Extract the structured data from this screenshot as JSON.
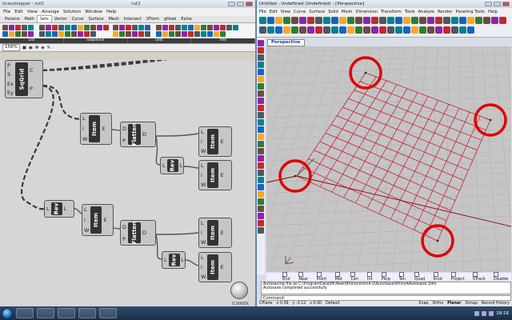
{
  "gh": {
    "title_left": "Grasshopper - tut2",
    "title_right": "tut2",
    "menu": [
      "File",
      "Edit",
      "View",
      "Arrange",
      "Solution",
      "Window",
      "Help"
    ],
    "tabs": [
      "Params",
      "Math",
      "Sets",
      "Vector",
      "Curve",
      "Surface",
      "Mesh",
      "Intersect",
      "XForm",
      "gHowl",
      "Extra"
    ],
    "active_tab": "Sets",
    "ribbon_groups": [
      "List",
      "Sequence",
      "Sets",
      "Tree"
    ],
    "zoom": "156%",
    "coord": "0.0000X",
    "components": {
      "sqgrid": {
        "name": "SqGrid",
        "inputs": [
          "P",
          "S",
          "Ex",
          "Ey"
        ],
        "outputs": [
          "C",
          "P"
        ]
      },
      "item1": {
        "name": "Item",
        "inputs": [
          "L",
          "i",
          "W"
        ],
        "outputs": [
          "E"
        ]
      },
      "flatten1": {
        "name": "Flatten",
        "inputs": [
          "D",
          "P"
        ],
        "outputs": [
          "D"
        ]
      },
      "item2": {
        "name": "Item",
        "inputs": [
          "L",
          "i",
          "W"
        ],
        "outputs": [
          "E"
        ]
      },
      "rev1": {
        "name": "Rev",
        "inputs": [
          "L"
        ],
        "outputs": [
          "L"
        ]
      },
      "item3": {
        "name": "Item",
        "inputs": [
          "L",
          "i",
          "W"
        ],
        "outputs": [
          "E"
        ]
      },
      "rev2": {
        "name": "Rev",
        "inputs": [
          "L"
        ],
        "outputs": [
          "L"
        ]
      },
      "item4": {
        "name": "Item",
        "inputs": [
          "L",
          "i",
          "W"
        ],
        "outputs": [
          "E"
        ]
      },
      "flatten2": {
        "name": "Flatten",
        "inputs": [
          "D",
          "P"
        ],
        "outputs": [
          "D"
        ]
      },
      "item5": {
        "name": "Item",
        "inputs": [
          "L",
          "i",
          "W"
        ],
        "outputs": [
          "E"
        ]
      },
      "rev3": {
        "name": "Rev",
        "inputs": [
          "L"
        ],
        "outputs": [
          "L"
        ]
      },
      "item6": {
        "name": "Item",
        "inputs": [
          "L",
          "i",
          "W"
        ],
        "outputs": [
          "E"
        ]
      }
    }
  },
  "rhino": {
    "title": "Untitled - Undefined (Undefined) - [Perspective]",
    "menu": [
      "File",
      "Edit",
      "View",
      "Curve",
      "Surface",
      "Solid",
      "Mesh",
      "Dimension",
      "Transform",
      "Tools",
      "Analyze",
      "Render",
      "Paneling Tools",
      "Help"
    ],
    "viewport_name": "Perspective",
    "osnaps": [
      "End",
      "Near",
      "Point",
      "Mid",
      "Cen",
      "Int",
      "Perp",
      "Tan",
      "Quad",
      "Knot",
      "Project",
      "STrack",
      "Disable"
    ],
    "history": [
      "Autosaving file as C:\\ProgramData\\McNeel\\Rhinoceros\\4.0\\AutoSave\\Rhino4Autosave.3dm",
      "Autosave completed successfully"
    ],
    "command_label": "Command:",
    "status": {
      "cplane": "CPlane",
      "x": "x 0.39",
      "y": "y -3.12",
      "z": "z 0.00",
      "layer": "Default",
      "toggles": [
        "Snap",
        "Ortho",
        "Planar",
        "Osnap",
        "Record History"
      ]
    },
    "accent_red": "#c8102e"
  },
  "taskbar": {
    "time": "18:16"
  }
}
